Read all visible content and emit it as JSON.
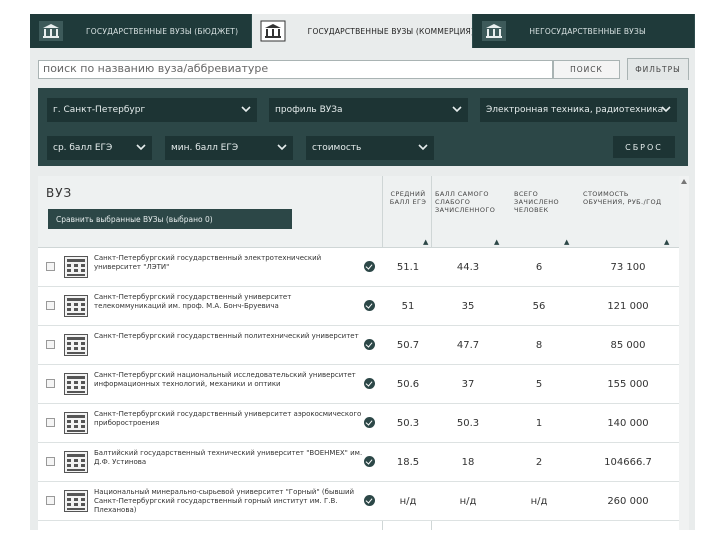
{
  "tabs": [
    {
      "label": "ГОСУДАРСТВЕННЫЕ ВУЗЫ (БЮДЖЕТ)",
      "icon": "university-icon",
      "active": false
    },
    {
      "label": "ГОСУДАРСТВЕННЫЕ ВУЗЫ (КОММЕРЦИЯ)",
      "icon": "university-icon",
      "active": true
    },
    {
      "label": "НЕГОСУДАРСТВЕННЫЕ ВУЗЫ",
      "icon": "university-icon",
      "active": false
    }
  ],
  "search": {
    "placeholder": "поиск по названию вуза/аббревиатуре",
    "button_label": "ПОИСК",
    "filters_label": "ФИЛЬТРЫ"
  },
  "filters": {
    "city": "г. Санкт-Петербург",
    "profile": "профиль ВУЗа",
    "specialty": "Электронная техника, радиотехника",
    "avg_score": "ср. балл ЕГЭ",
    "min_score": "мин. балл ЕГЭ",
    "cost": "стоимость",
    "reset_label": "СБРОС"
  },
  "results": {
    "title": "ВУЗ",
    "compare_label": "Сравнить выбранные ВУЗы (выбрано 0)",
    "columns": [
      {
        "label": "СРЕДНИЙ БАЛЛ ЕГЭ"
      },
      {
        "label": "БАЛЛ САМОГО СЛАБОГО ЗАЧИСЛЕННОГО"
      },
      {
        "label": "ВСЕГО ЗАЧИСЛЕНО ЧЕЛОВЕК"
      },
      {
        "label": "СТОИМОСТЬ ОБУЧЕНИЯ, РУБ./ГОД"
      }
    ],
    "sort_icon": "sort-arrows-icon",
    "rows": [
      {
        "name": "Санкт-Петербургский государственный электротехнический университет \"ЛЭТИ\"",
        "avg": "51.1",
        "min": "44.3",
        "count": "6",
        "cost": "73 100"
      },
      {
        "name": "Санкт-Петербургский государственный университет телекоммуникаций им. проф. М.А. Бонч-Бруевича",
        "avg": "51",
        "min": "35",
        "count": "56",
        "cost": "121 000"
      },
      {
        "name": "Санкт-Петербургский государственный политехнический университет",
        "avg": "50.7",
        "min": "47.7",
        "count": "8",
        "cost": "85 000"
      },
      {
        "name": "Санкт-Петербургский национальный исследовательский университет информационных технологий, механики и оптики",
        "avg": "50.6",
        "min": "37",
        "count": "5",
        "cost": "155 000"
      },
      {
        "name": "Санкт-Петербургский государственный университет аэрокосмического приборостроения",
        "avg": "50.3",
        "min": "50.3",
        "count": "1",
        "cost": "140 000"
      },
      {
        "name": "Балтийский государственный технический университет \"ВОЕНМЕХ\" им. Д.Ф. Устинова",
        "avg": "18.5",
        "min": "18",
        "count": "2",
        "cost": "104666.7"
      },
      {
        "name": "Национальный минерально-сырьевой университет \"Горный\" (бывший Санкт-Петербургский государственный горный институт им. Г.В. Плеханова)",
        "avg": "н/д",
        "min": "н/д",
        "count": "н/д",
        "cost": "260 000"
      }
    ]
  },
  "colors": {
    "accent": "#2c4747",
    "dark": "#1d3434",
    "tabbar": "#1f3a3a"
  }
}
